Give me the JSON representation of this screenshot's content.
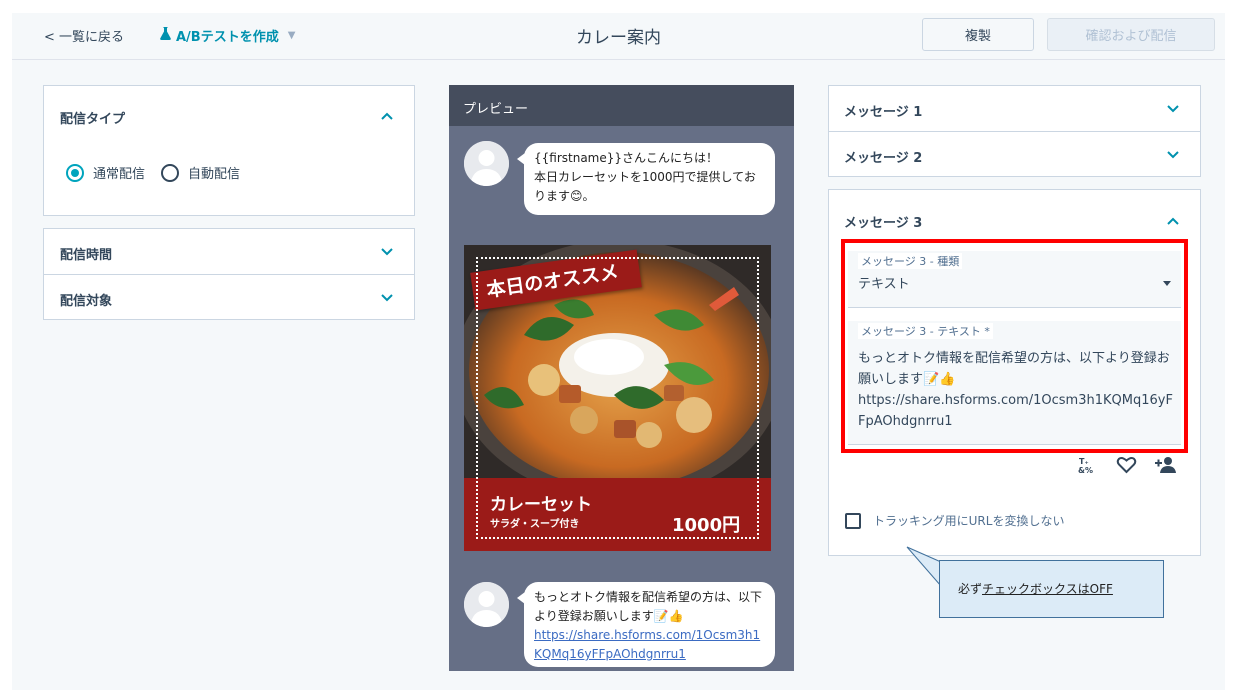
{
  "header": {
    "back_label": "< 一覧に戻る",
    "ab_label": "A/Bテストを作成",
    "title": "カレー案内",
    "duplicate_label": "複製",
    "confirm_label": "確認および配信"
  },
  "left": {
    "type_title": "配信タイプ",
    "radio_normal": "通常配信",
    "radio_auto": "自動配信",
    "time_title": "配信時間",
    "target_title": "配信対象"
  },
  "preview": {
    "title": "プレビュー",
    "msg1_line1": "{{firstname}}さんこんにちは！",
    "msg1_line2": "本日カレーセットを1000円で提供しております😊。",
    "banner": "本日のオススメ",
    "card_name": "カレーセット",
    "card_sub": "サラダ・スープ付き",
    "card_price": "1000円",
    "msg3_text": "もっとオトク情報を配信希望の方は、以下より登録お願いします📝👍",
    "msg3_link": "https://share.hsforms.com/1Ocsm3h1KQMq16yFFpAOhdgnrru1"
  },
  "right": {
    "msg1_title": "メッセージ 1",
    "msg2_title": "メッセージ 2",
    "msg3_title": "メッセージ 3",
    "type_label": "メッセージ 3 - 種類",
    "type_value": "テキスト",
    "text_label": "メッセージ 3 - テキスト *",
    "text_value_line": "もっとオトク情報を配信希望の方は、以下より登録お願いします📝👍",
    "text_value_url": "https://share.hsforms.com/1Ocsm3h1KQMq16yFFpAOhdgnrru1",
    "checkbox_label": "トラッキング用にURLを変換しない"
  },
  "callout": {
    "prefix": "必ず",
    "underlined": "チェックボックスはOFF"
  },
  "colors": {
    "accent": "#00a4bd",
    "link": "#0091ae",
    "highlight": "#ff0000",
    "card_red": "#9b1b18"
  }
}
